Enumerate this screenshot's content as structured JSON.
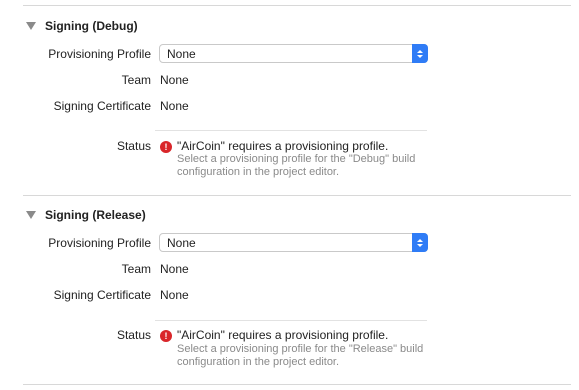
{
  "signing_debug": {
    "title": "Signing (Debug)",
    "provisioning_profile_label": "Provisioning Profile",
    "provisioning_profile_value": "None",
    "team_label": "Team",
    "team_value": "None",
    "certificate_label": "Signing Certificate",
    "certificate_value": "None",
    "status_label": "Status",
    "status_message": "\"AirCoin\" requires a provisioning profile.",
    "status_detail": "Select a provisioning profile for the \"Debug\" build configuration in the project editor."
  },
  "signing_release": {
    "title": "Signing (Release)",
    "provisioning_profile_label": "Provisioning Profile",
    "provisioning_profile_value": "None",
    "team_label": "Team",
    "team_value": "None",
    "certificate_label": "Signing Certificate",
    "certificate_value": "None",
    "status_label": "Status",
    "status_message": "\"AirCoin\" requires a provisioning profile.",
    "status_detail": "Select a provisioning profile for the \"Release\" build configuration in the project editor."
  },
  "colors": {
    "accent": "#2f7cf6",
    "error": "#d9262a",
    "secondary_text": "#8a8a8a"
  },
  "icons": {
    "disclosure": "disclosure-triangle-icon",
    "stepper": "popup-stepper-icon",
    "error": "error-icon"
  }
}
